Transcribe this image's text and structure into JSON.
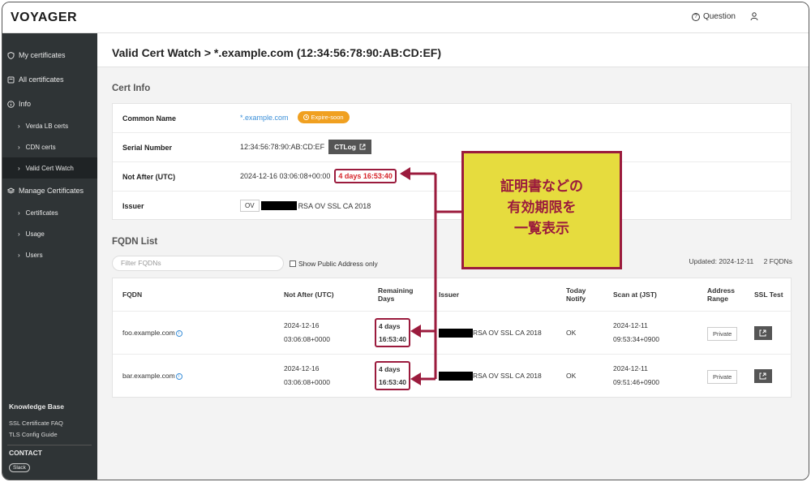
{
  "app": {
    "logo": "VOYAGER",
    "question_label": "Question"
  },
  "sidebar": {
    "items": [
      {
        "label": "My certificates",
        "icon": "shield-icon"
      },
      {
        "label": "All certificates",
        "icon": "folder-icon"
      },
      {
        "label": "Info",
        "icon": "info-icon"
      },
      {
        "label": "Verda LB certs"
      },
      {
        "label": "CDN certs"
      },
      {
        "label": "Valid Cert Watch"
      },
      {
        "label": "Manage Certificates",
        "icon": "layers-icon"
      },
      {
        "label": "Certificates"
      },
      {
        "label": "Usage"
      },
      {
        "label": "Users"
      }
    ],
    "knowledge_base": {
      "title": "Knowledge Base",
      "links": [
        "SSL Certificate FAQ",
        "TLS Config Guide"
      ]
    },
    "contact": {
      "title": "CONTACT",
      "slack": "Slack"
    }
  },
  "page": {
    "title": "Valid Cert Watch > *.example.com (12:34:56:78:90:AB:CD:EF)"
  },
  "cert_info": {
    "title": "Cert Info",
    "common_name_label": "Common Name",
    "common_name": "*.example.com",
    "expire_badge": "Expire-soon",
    "serial_label": "Serial Number",
    "serial": "12:34:56:78:90:AB:CD:EF",
    "ctlog_button": "CTLog",
    "not_after_label": "Not After (UTC)",
    "not_after": "2024-12-16 03:06:08+00:00",
    "remaining": "4 days 16:53:40",
    "issuer_label": "Issuer",
    "issuer_country": "OV",
    "issuer_name": "RSA OV SSL CA 2018"
  },
  "fqdn": {
    "title": "FQDN List",
    "filter_placeholder": "Filter FQDNs",
    "show_public_label": "Show Public Address only",
    "updated": "Updated: 2024-12-11",
    "count": "2 FQDNs",
    "headers": {
      "fqdn": "FQDN",
      "not_after": "Not After (UTC)",
      "remaining_1": "Remaining",
      "remaining_2": "Days",
      "issuer": "Issuer",
      "today_1": "Today",
      "today_2": "Notify",
      "scan": "Scan at (JST)",
      "address_1": "Address",
      "address_2": "Range",
      "ssl": "SSL Test"
    },
    "rows": [
      {
        "fqdn": "foo.example.com",
        "not_after_1": "2024-12-16",
        "not_after_2": "03:06:08+0000",
        "remaining_1": "4 days",
        "remaining_2": "16:53:40",
        "issuer": "RSA OV SSL CA 2018",
        "notify": "OK",
        "scan_1": "2024-12-11",
        "scan_2": "09:53:34+0900",
        "range": "Private"
      },
      {
        "fqdn": "bar.example.com",
        "not_after_1": "2024-12-16",
        "not_after_2": "03:06:08+0000",
        "remaining_1": "4 days",
        "remaining_2": "16:53:40",
        "issuer": "RSA OV SSL CA 2018",
        "notify": "OK",
        "scan_1": "2024-12-11",
        "scan_2": "09:51:46+0900",
        "range": "Private"
      }
    ]
  },
  "annotation": {
    "lines": [
      "証明書などの",
      "有効期限を",
      "一覧表示"
    ]
  },
  "colors": {
    "accent_red": "#9b1b3d",
    "remaining_red": "#d6242a",
    "expire_orange": "#f0a020",
    "note_yellow": "#e6dc3e",
    "sidebar": "#2f3436"
  }
}
